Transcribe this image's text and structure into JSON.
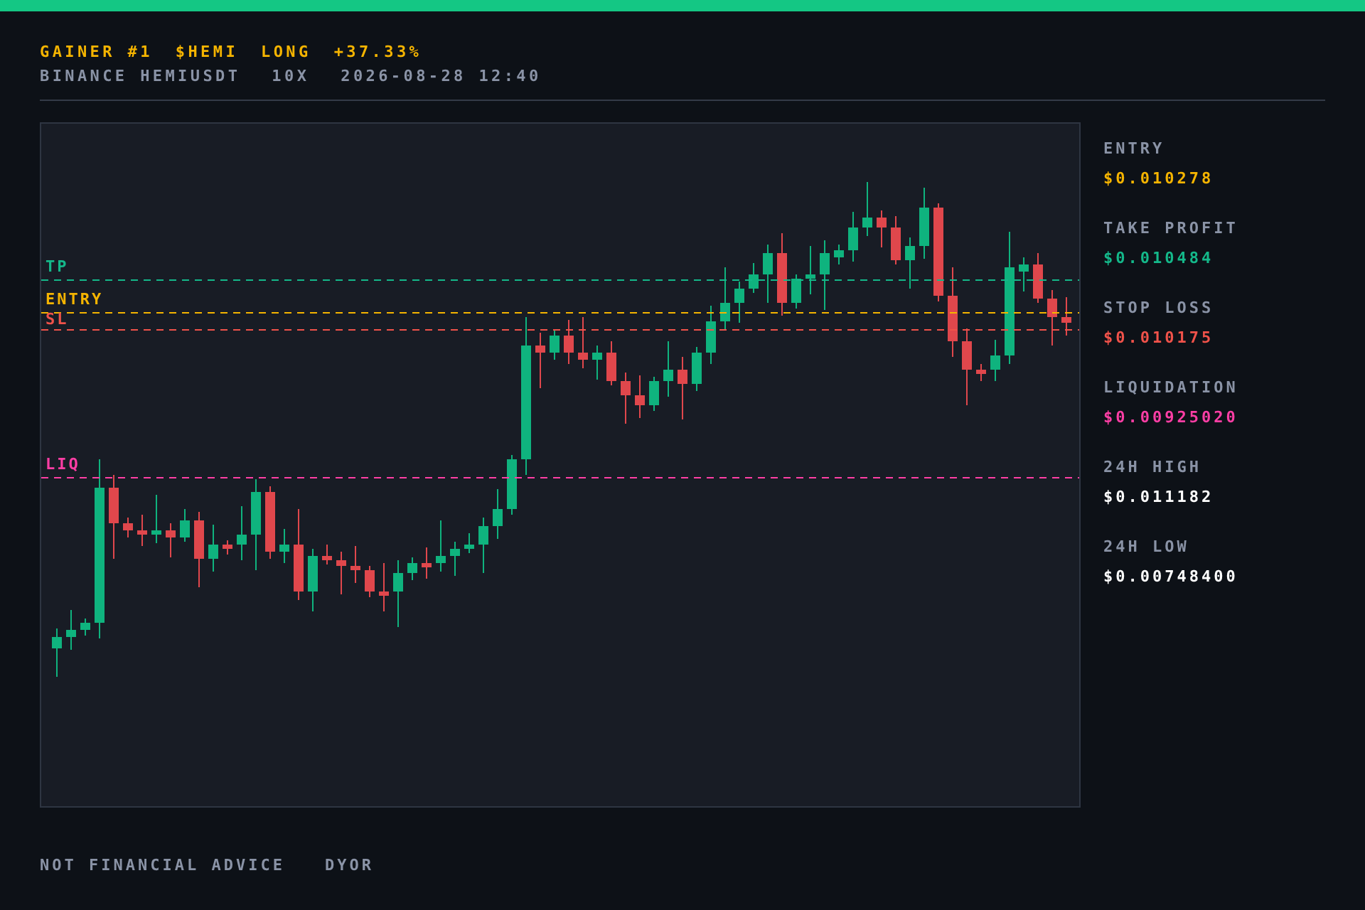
{
  "header": {
    "title_parts": [
      "GAINER #1",
      "$HEMI",
      "LONG",
      "+37.33%"
    ],
    "meta_parts": [
      "BINANCE HEMIUSDT",
      "10X",
      "2026-08-28 12:40"
    ]
  },
  "chart": {
    "levels": [
      {
        "kind": "tp",
        "label": "TP",
        "color": "#14b88a"
      },
      {
        "kind": "entry",
        "label": "ENTRY",
        "color": "#f5b400"
      },
      {
        "kind": "sl",
        "label": "SL",
        "color": "#f0524a"
      },
      {
        "kind": "liq",
        "label": "LIQ",
        "color": "#ff3ea5"
      }
    ]
  },
  "stats": [
    {
      "label": "ENTRY",
      "value": "$0.010278",
      "color": "#f5b400"
    },
    {
      "label": "TAKE PROFIT",
      "value": "$0.010484",
      "color": "#14b88a"
    },
    {
      "label": "STOP LOSS",
      "value": "$0.010175",
      "color": "#f0524a"
    },
    {
      "label": "LIQUIDATION",
      "value": "$0.00925020",
      "color": "#ff3ea5"
    },
    {
      "label": "24H HIGH",
      "value": "$0.011182",
      "color": "#ffffff"
    },
    {
      "label": "24H LOW",
      "value": "$0.00748400",
      "color": "#ffffff"
    }
  ],
  "footer": {
    "parts": [
      "NOT FINANCIAL ADVICE",
      "DYOR"
    ]
  }
}
